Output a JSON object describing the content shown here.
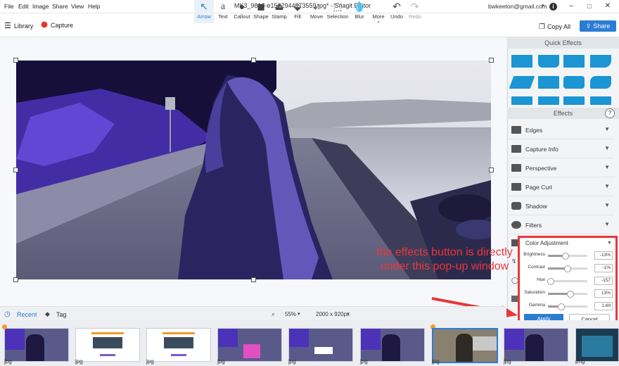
{
  "menu": [
    "File",
    "Edit",
    "Image",
    "Share",
    "View",
    "Help"
  ],
  "window": {
    "title": "MK3_9818-e1522944973559.jpg* - Snagit Editor",
    "user": "bwkeeton@gmail.com"
  },
  "nav": {
    "library": "Library",
    "capture": "Capture"
  },
  "tools": [
    {
      "label": "Arrow",
      "icon": "arrow-icon"
    },
    {
      "label": "Text",
      "icon": "text-icon"
    },
    {
      "label": "Callout",
      "icon": "callout-icon"
    },
    {
      "label": "Shape",
      "icon": "shape-icon"
    },
    {
      "label": "Stamp",
      "icon": "stamp-icon"
    },
    {
      "label": "Fill",
      "icon": "fill-icon"
    },
    {
      "label": "Move",
      "icon": "move-icon"
    },
    {
      "label": "Selection",
      "icon": "selection-icon"
    },
    {
      "label": "Blur",
      "icon": "blur-icon"
    },
    {
      "label": "More",
      "icon": "more-icon"
    },
    {
      "label": "Undo",
      "icon": "undo-icon"
    },
    {
      "label": "Redo",
      "icon": "redo-icon"
    }
  ],
  "actions": {
    "copy_all": "Copy All",
    "share": "Share"
  },
  "panel": {
    "quick_effects": "Quick Effects",
    "effects": "Effects",
    "items": [
      "Edges",
      "Capture Info",
      "Perspective",
      "Page Curl",
      "Shadow",
      "Filters"
    ]
  },
  "color_adjustment": {
    "title": "Color Adjustment",
    "sliders": [
      {
        "label": "Brightness",
        "value": "-13%",
        "level": 0.43
      },
      {
        "label": "Contrast",
        "value": "-1%",
        "level": 0.49
      },
      {
        "label": "Hue",
        "value": "-157",
        "level": 0.06
      },
      {
        "label": "Saturation",
        "value": "13%",
        "level": 0.56
      },
      {
        "label": "Gamma",
        "value": "1.69",
        "level": 0.33
      }
    ],
    "apply": "Apply",
    "cancel": "Cancel"
  },
  "annotation": "the effects button is directly under this pop-up window",
  "bottom": {
    "recent": "Recent",
    "tag": "Tag",
    "zoom": "55%",
    "size": "2000 x 920px"
  },
  "tray": {
    "extensions": [
      "jpg",
      "jpg",
      "jpg",
      "jpg",
      "jpg",
      "jpg",
      "jpg",
      "jpg",
      "png"
    ]
  },
  "colors": {
    "accent": "#2b7cd3",
    "annotation": "#e8373b",
    "quick_effect": "#1b95d3"
  }
}
